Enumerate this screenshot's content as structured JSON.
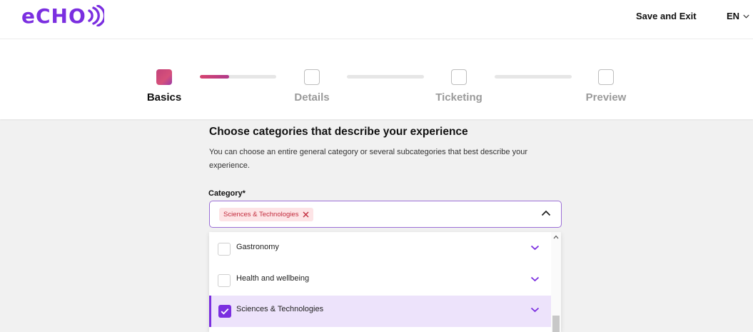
{
  "header": {
    "logo": {
      "text": "eCHO",
      "icon": "sound-waves-icon",
      "color": "#7b2fe0"
    },
    "save_exit": "Save and Exit",
    "language": "EN"
  },
  "stepper": {
    "steps": [
      {
        "label": "Basics",
        "active": true
      },
      {
        "label": "Details",
        "active": false
      },
      {
        "label": "Ticketing",
        "active": false
      },
      {
        "label": "Preview",
        "active": false
      }
    ],
    "progress": [
      0.38,
      0,
      0
    ]
  },
  "form": {
    "title": "Choose categories that describe your experience",
    "description": "You can choose an entire general category or several subcategories that best describe your experience.",
    "category_label": "Category*",
    "selected_chip": "Sciences & Technologies",
    "options": [
      {
        "label": "Gastronomy",
        "checked": false
      },
      {
        "label": "Health and wellbeing",
        "checked": false
      },
      {
        "label": "Sciences & Technologies",
        "checked": true
      }
    ]
  },
  "colors": {
    "accent": "#7b2fe0",
    "chip_bg": "#fde4e6",
    "chip_text": "#c22b3d",
    "selected_row": "#ede3fb"
  }
}
